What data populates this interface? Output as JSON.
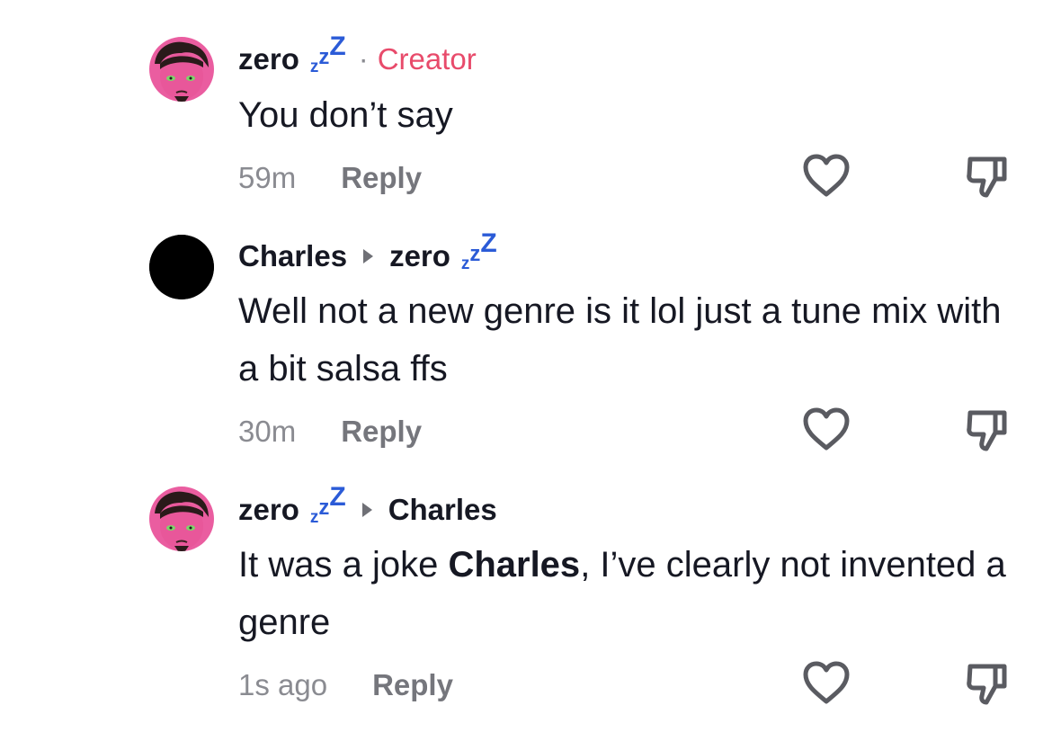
{
  "colors": {
    "text": "#161823",
    "muted": "#8a8b91",
    "reply": "#75767c",
    "creator": "#e84b6b",
    "zzz": "#2b5bd7",
    "icon": "#5a5b61"
  },
  "comments": [
    {
      "author": "zero",
      "author_badge": "zZZ",
      "separator": "·",
      "role": "Creator",
      "text": "You don’t say",
      "time": "59m",
      "reply_label": "Reply",
      "avatar": "pink-face-avatar"
    },
    {
      "author": "Charles",
      "reply_to": "zero",
      "reply_to_badge": "zZZ",
      "text": "Well not a new genre is it lol just a tune mix with a bit salsa ffs",
      "time": "30m",
      "reply_label": "Reply",
      "avatar": "black-circle-avatar"
    },
    {
      "author": "zero",
      "author_badge": "zZZ",
      "reply_to": "Charles",
      "text_before": "It was a joke ",
      "text_mention": "Charles",
      "text_after": ", I’ve clearly not invented a genre",
      "time": "1s ago",
      "reply_label": "Reply",
      "avatar": "pink-face-avatar"
    }
  ],
  "icons": {
    "like": "heart-icon",
    "dislike": "thumbs-down-icon"
  }
}
